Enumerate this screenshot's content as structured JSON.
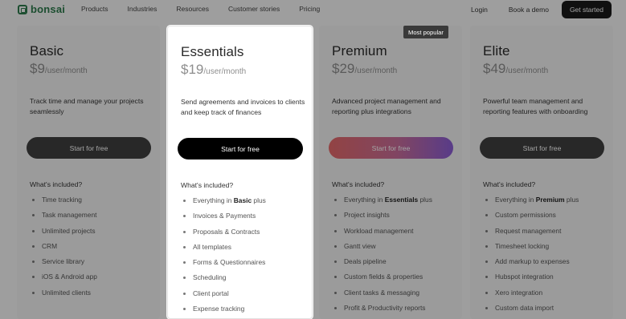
{
  "nav": {
    "logo": "bonsai",
    "links": [
      "Products",
      "Industries",
      "Resources",
      "Customer stories",
      "Pricing"
    ],
    "login": "Login",
    "demo": "Book a demo",
    "cta": "Get started"
  },
  "badge": "Most popular",
  "plans": [
    {
      "name": "Basic",
      "price": "$9",
      "unit": "/user/month",
      "description": "Track time and manage your projects seamlessly",
      "cta": "Start for free",
      "included_label": "What's included?",
      "features": [
        "Time tracking",
        "Task management",
        "Unlimited projects",
        "CRM",
        "Service library",
        "iOS & Android app",
        "Unlimited clients"
      ]
    },
    {
      "name": "Essentials",
      "price": "$19",
      "unit": "/user/month",
      "description": "Send agreements and invoices to clients and keep track of finances",
      "cta": "Start for free",
      "included_label": "What's included?",
      "features_intro_prefix": "Everything in ",
      "features_intro_bold": "Basic",
      "features_intro_suffix": " plus",
      "features": [
        "Invoices & Payments",
        "Proposals & Contracts",
        "All templates",
        "Forms & Questionnaires",
        "Scheduling",
        "Client portal",
        "Expense tracking"
      ]
    },
    {
      "name": "Premium",
      "price": "$29",
      "unit": "/user/month",
      "description": "Advanced project management and reporting plus integrations",
      "cta": "Start for free",
      "included_label": "What's included?",
      "features_intro_prefix": "Everything in ",
      "features_intro_bold": "Essentials",
      "features_intro_suffix": " plus",
      "features": [
        "Project insights",
        "Workload management",
        "Gantt view",
        "Deals pipeline",
        "Custom fields & properties",
        "Client tasks & messaging",
        "Profit & Productivity reports"
      ]
    },
    {
      "name": "Elite",
      "price": "$49",
      "unit": "/user/month",
      "description": "Powerful team management and reporting features with onboarding",
      "cta": "Start for free",
      "included_label": "What's included?",
      "features_intro_prefix": "Everything in ",
      "features_intro_bold": "Premium",
      "features_intro_suffix": " plus",
      "features": [
        "Custom permissions",
        "Request management",
        "Timesheet locking",
        "Add markup to expenses",
        "Hubspot integration",
        "Xero integration",
        "Custom data import"
      ]
    }
  ]
}
